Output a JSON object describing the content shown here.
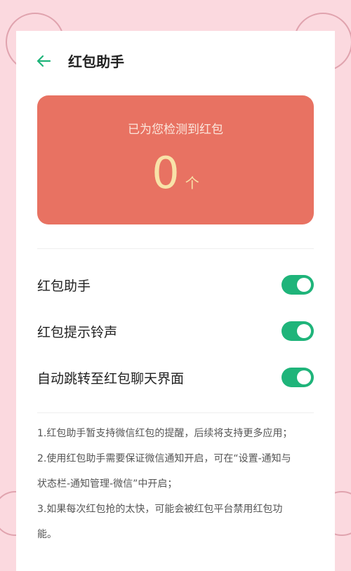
{
  "header": {
    "title": "红包助手",
    "back_icon": "arrow-left-icon"
  },
  "summary": {
    "subtitle": "已为您检测到红包",
    "count": "0",
    "unit": "个"
  },
  "settings": [
    {
      "label": "红包助手",
      "enabled": true
    },
    {
      "label": "红包提示铃声",
      "enabled": true
    },
    {
      "label": "自动跳转至红包聊天界面",
      "enabled": true
    }
  ],
  "notes": [
    "1.红包助手暂支持微信红包的提醒，后续将支持更多应用；",
    "2.使用红包助手需要保证微信通知开启，可在“设置-通知与",
    "状态栏-通知管理-微信”中开启；",
    "3.如果每次红包抢的太快，可能会被红包平台禁用红包功",
    "能。"
  ],
  "colors": {
    "accent": "#1fb47a",
    "red_card": "#e87262",
    "count_text": "#f8e2a8",
    "background": "#fbd9df"
  }
}
